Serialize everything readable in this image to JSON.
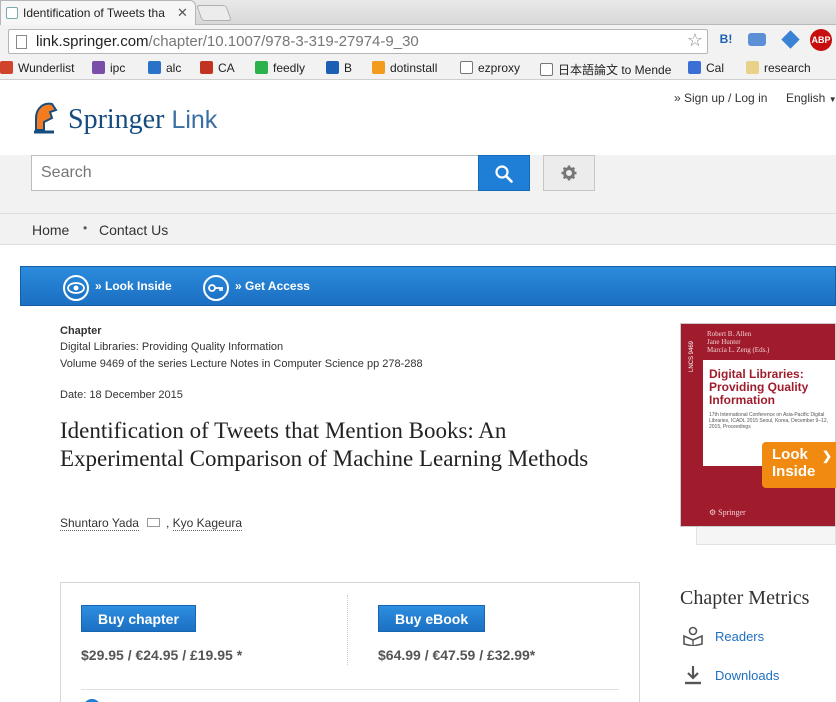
{
  "browser": {
    "tab_title": "Identification of Tweets tha",
    "tab_close": "✕",
    "url_host": "link.springer.com",
    "url_path": "/chapter/10.1007/978-3-319-27974-9_30",
    "bookmark_star": "☆",
    "extensions": {
      "hatena": "B!",
      "abp": "ABP"
    },
    "bookmarks": [
      {
        "label": "Wunderlist",
        "color": "#d1442c"
      },
      {
        "label": "ipc",
        "color": "#7a4ea8"
      },
      {
        "label": "alc",
        "color": "#2a72c8"
      },
      {
        "label": "CA",
        "color": "#c23322"
      },
      {
        "label": "feedly",
        "color": "#2bb24c"
      },
      {
        "label": "B",
        "color": "#1a5fb4"
      },
      {
        "label": "dotinstall",
        "color": "#f29b1d"
      },
      {
        "label": "ezproxy",
        "color": "#ffffff"
      },
      {
        "label": "日本語論文 to Mende",
        "color": "#ffffff"
      },
      {
        "label": "Cal",
        "color": "#3b6fd6"
      },
      {
        "label": "research",
        "color": "#e8d28a"
      }
    ]
  },
  "header": {
    "brand": "Springer",
    "brand_link": "Link",
    "signup": "» Sign up / Log in",
    "language": "English"
  },
  "search": {
    "placeholder": "Search"
  },
  "nav": {
    "home": "Home",
    "separator": "•",
    "contact": "Contact Us"
  },
  "actions": {
    "look_inside": "» Look Inside",
    "get_access": "» Get Access"
  },
  "chapter": {
    "type": "Chapter",
    "book": "Digital Libraries: Providing Quality Information",
    "series": "Volume 9469 of the series Lecture Notes in Computer Science pp 278-288",
    "date": "Date: 18 December 2015",
    "title": "Identification of Tweets that Mention Books: An Experimental Comparison of Machine Learning Methods",
    "author1": "Shuntaro Yada",
    "author_sep": ",",
    "author2": "Kyo Kageura"
  },
  "purchase": {
    "chapter_button": "Buy chapter",
    "chapter_price": "$29.95 / €24.95 / £19.95 *",
    "ebook_button": "Buy eBook",
    "ebook_price": "$64.99 / €47.59 / £32.99*"
  },
  "cover": {
    "editors": "Robert B. Allen\nJane Hunter\nMarcia L. Zeng (Eds.)",
    "title": "Digital Libraries: Providing Quality Information",
    "conference": "17th International Conference on Asia-Pacific Digital Libraries, ICADL 2015 Seoul, Korea, December 9–12, 2015, Proceedings",
    "spine": "LNCS 9469",
    "publisher": "⚙ Springer",
    "look_inside": "Look Inside",
    "look_inside_arrow": "❯"
  },
  "metrics": {
    "title": "Chapter Metrics",
    "readers": "Readers",
    "downloads": "Downloads"
  }
}
